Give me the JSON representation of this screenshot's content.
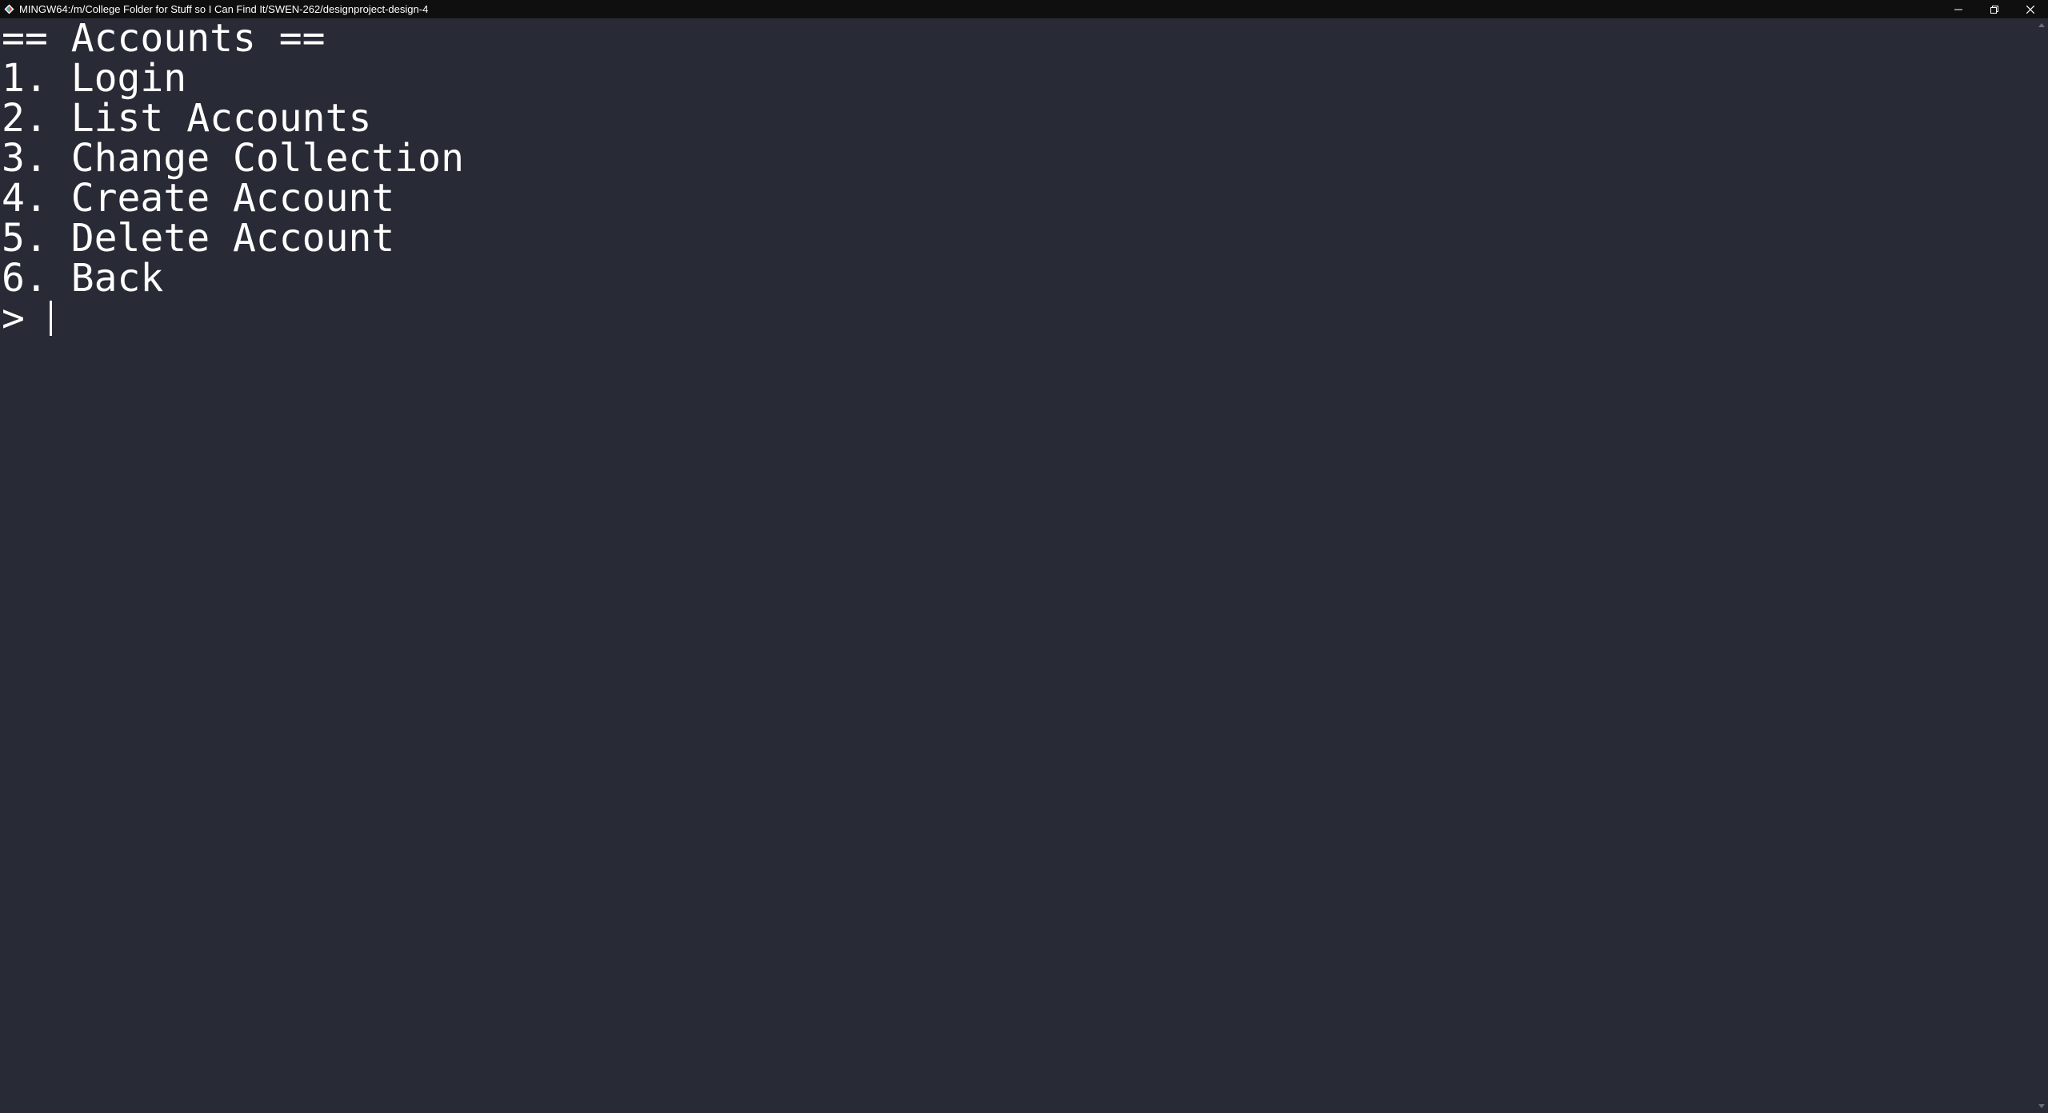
{
  "window": {
    "title": "MINGW64:/m/College Folder for Stuff so I Can Find It/SWEN-262/designproject-design-4",
    "app_icon": "git-bash-icon",
    "controls": [
      "minimize-icon",
      "restore-icon",
      "close-icon"
    ]
  },
  "terminal": {
    "heading": "== Accounts ==",
    "menu": [
      "1. Login",
      "2. List Accounts",
      "3. Change Collection",
      "4. Create Account",
      "5. Delete Account",
      "6. Back"
    ],
    "prompt": "> "
  },
  "colors": {
    "background": "#282b35",
    "titlebar": "#0f0f10",
    "text": "#ffffff"
  }
}
